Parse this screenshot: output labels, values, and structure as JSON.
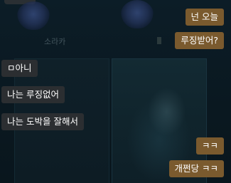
{
  "background": {
    "rank_label": "소라카"
  },
  "messages": [
    {
      "sender": "me",
      "text": "넌 오늘"
    },
    {
      "sender": "me",
      "text": "루징받어?"
    },
    {
      "sender": "other",
      "text": "ㅁ아니"
    },
    {
      "sender": "other",
      "text": "나는 루징없어"
    },
    {
      "sender": "other",
      "text": "나는 도박을 잘해서"
    },
    {
      "sender": "me",
      "text": "ㅋㅋ"
    },
    {
      "sender": "me",
      "text": "개쩐당 ㅋㅋ"
    }
  ],
  "colors": {
    "my_bubble": "#7a5a2e",
    "other_bubble": "#2b2e31",
    "background": "#0b1a22"
  }
}
